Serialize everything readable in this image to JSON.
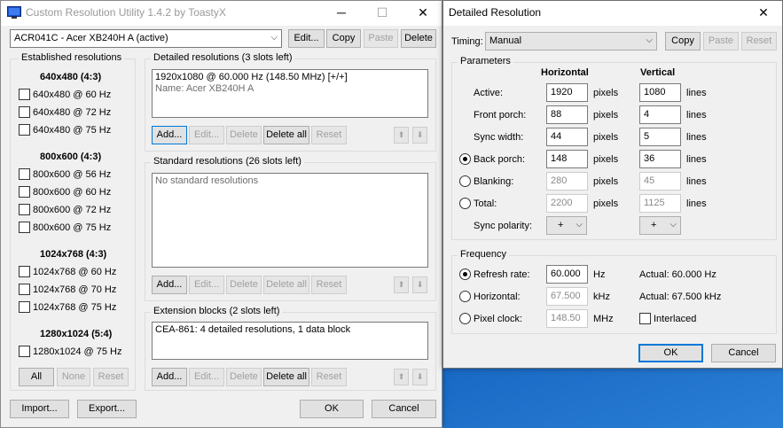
{
  "main_window": {
    "title": "Custom Resolution Utility 1.4.2 by ToastyX",
    "title_controls": {
      "minimize": "─",
      "maximize": "☐",
      "close": "✕"
    },
    "monitor_select": "ACR041C - Acer XB240H A (active)",
    "top_buttons": {
      "edit": "Edit...",
      "copy": "Copy",
      "paste": "Paste",
      "delete": "Delete"
    },
    "established": {
      "label": "Established resolutions",
      "groups": [
        {
          "heading": "640x480 (4:3)",
          "items": [
            "640x480 @ 60 Hz",
            "640x480 @ 72 Hz",
            "640x480 @ 75 Hz"
          ]
        },
        {
          "heading": "800x600 (4:3)",
          "items": [
            "800x600 @ 56 Hz",
            "800x600 @ 60 Hz",
            "800x600 @ 72 Hz",
            "800x600 @ 75 Hz"
          ]
        },
        {
          "heading": "1024x768 (4:3)",
          "items": [
            "1024x768 @ 60 Hz",
            "1024x768 @ 70 Hz",
            "1024x768 @ 75 Hz"
          ]
        },
        {
          "heading": "1280x1024 (5:4)",
          "items": [
            "1280x1024 @ 75 Hz"
          ]
        }
      ],
      "buttons": {
        "all": "All",
        "none": "None",
        "reset": "Reset"
      }
    },
    "detailed": {
      "label": "Detailed resolutions (3 slots left)",
      "entries": [
        "1920x1080 @ 60.000 Hz (148.50 MHz) [+/+]"
      ],
      "name_line": "Name: Acer XB240H A",
      "buttons": {
        "add": "Add...",
        "edit": "Edit...",
        "delete": "Delete",
        "delete_all": "Delete all",
        "reset": "Reset"
      }
    },
    "standard": {
      "label": "Standard resolutions (26 slots left)",
      "empty_text": "No standard resolutions",
      "buttons": {
        "add": "Add...",
        "edit": "Edit...",
        "delete": "Delete",
        "delete_all": "Delete all",
        "reset": "Reset"
      }
    },
    "extension": {
      "label": "Extension blocks (2 slots left)",
      "entries": [
        "CEA-861: 4 detailed resolutions, 1 data block"
      ],
      "buttons": {
        "add": "Add...",
        "edit": "Edit...",
        "delete": "Delete",
        "delete_all": "Delete all",
        "reset": "Reset"
      }
    },
    "arrows": {
      "up": "⬆",
      "down": "⬇"
    },
    "bottom_buttons": {
      "import": "Import...",
      "export": "Export...",
      "ok": "OK",
      "cancel": "Cancel"
    }
  },
  "dialog": {
    "title": "Detailed Resolution",
    "close": "✕",
    "timing_label": "Timing:",
    "timing_value": "Manual",
    "buttons": {
      "copy": "Copy",
      "paste": "Paste",
      "reset": "Reset",
      "ok": "OK",
      "cancel": "Cancel"
    },
    "parameters": {
      "label": "Parameters",
      "col_h": "Horizontal",
      "col_v": "Vertical",
      "rows": [
        {
          "label": "Active:",
          "h": "1920",
          "h_unit": "pixels",
          "v": "1080",
          "v_unit": "lines"
        },
        {
          "label": "Front porch:",
          "h": "88",
          "h_unit": "pixels",
          "v": "4",
          "v_unit": "lines"
        },
        {
          "label": "Sync width:",
          "h": "44",
          "h_unit": "pixels",
          "v": "5",
          "v_unit": "lines"
        },
        {
          "label": "Back porch:",
          "h": "148",
          "h_unit": "pixels",
          "v": "36",
          "v_unit": "lines"
        },
        {
          "label": "Blanking:",
          "h": "280",
          "h_unit": "pixels",
          "v": "45",
          "v_unit": "lines"
        },
        {
          "label": "Total:",
          "h": "2200",
          "h_unit": "pixels",
          "v": "1125",
          "v_unit": "lines"
        }
      ],
      "sync_label": "Sync polarity:",
      "sync_h": "+",
      "sync_v": "+"
    },
    "frequency": {
      "label": "Frequency",
      "refresh_label": "Refresh rate:",
      "refresh_value": "60.000",
      "refresh_unit": "Hz",
      "refresh_actual": "Actual: 60.000 Hz",
      "horizontal_label": "Horizontal:",
      "horizontal_value": "67.500",
      "horizontal_unit": "kHz",
      "horizontal_actual": "Actual: 67.500 kHz",
      "pixel_label": "Pixel clock:",
      "pixel_value": "148.50",
      "pixel_unit": "MHz",
      "interlaced_label": "Interlaced"
    }
  },
  "colors": {
    "accent": "#0078d7",
    "desktop": "#0d47a1",
    "window_bg": "#f0f0f0"
  }
}
